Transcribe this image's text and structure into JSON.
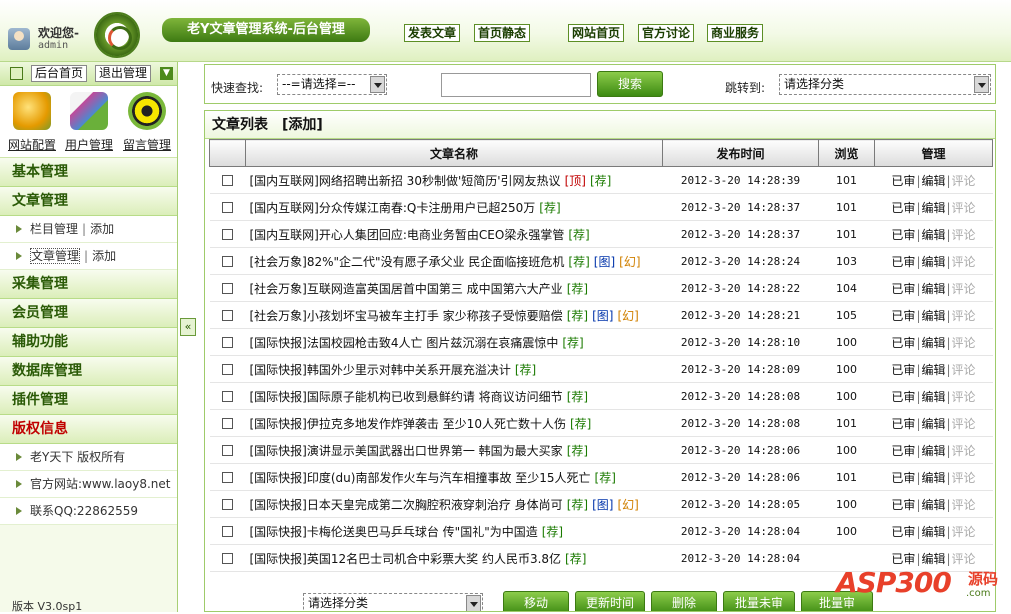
{
  "header": {
    "welcome": "欢迎您-",
    "username": "admin",
    "system_title": "老Y文章管理系统-后台管理",
    "top_buttons": [
      "发表文章",
      "首页静态",
      "网站首页",
      "官方讨论",
      "商业服务"
    ]
  },
  "sidebar": {
    "top_buttons": [
      "后台首页",
      "退出管理"
    ],
    "quick_links": [
      "网站配置",
      "用户管理",
      "留言管理"
    ],
    "menu": {
      "basic": "基本管理",
      "article": "文章管理",
      "column_manage": "栏目管理",
      "add": "添加",
      "separator": "|",
      "article_manage": "文章管理",
      "collect": "采集管理",
      "member": "会员管理",
      "assist": "辅助功能",
      "database": "数据库管理",
      "plugin": "插件管理",
      "copyright": "版权信息",
      "copyright_items": [
        "老Y天下 版权所有",
        "官方网站:www.laoy8.net",
        "联系QQ:22862559"
      ]
    },
    "footer": "版本 V3.0sp1",
    "collapse_icon": "«"
  },
  "search": {
    "quick_find_label": "快速查找:",
    "quick_find_select": "--=请选择=--",
    "keyword_value": "",
    "search_button": "搜索",
    "jump_label": "跳转到:",
    "jump_select": "请选择分类"
  },
  "list": {
    "title": "文章列表",
    "add": "[添加]",
    "columns": [
      "",
      "文章名称",
      "发布时间",
      "浏览",
      "管理"
    ],
    "manage_actions": [
      "已审",
      "编辑",
      "评论"
    ],
    "rows": [
      {
        "title": "[国内互联网]网络招聘出新招 30秒制做'短简历'引网友热议",
        "tags": [
          "[顶]",
          "[荐]"
        ],
        "time": "2012-3-20 14:28:39",
        "views": "101"
      },
      {
        "title": "[国内互联网]分众传媒江南春:Q卡注册用户已超250万",
        "tags": [
          "[荐]"
        ],
        "time": "2012-3-20 14:28:37",
        "views": "101"
      },
      {
        "title": "[国内互联网]开心人集团回应:电商业务暂由CEO梁永强掌管",
        "tags": [
          "[荐]"
        ],
        "time": "2012-3-20 14:28:37",
        "views": "101"
      },
      {
        "title": "[社会万象]82%\"企二代\"没有愿子承父业 民企面临接班危机",
        "tags": [
          "[荐]",
          "[图]",
          "[幻]"
        ],
        "time": "2012-3-20 14:28:24",
        "views": "103"
      },
      {
        "title": "[社会万象]互联网造富英国居首中国第三 成中国第六大产业",
        "tags": [
          "[荐]"
        ],
        "time": "2012-3-20 14:28:22",
        "views": "104"
      },
      {
        "title": "[社会万象]小孩划坏宝马被车主打手 家少称孩子受惊要赔偿",
        "tags": [
          "[荐]",
          "[图]",
          "[幻]"
        ],
        "time": "2012-3-20 14:28:21",
        "views": "105"
      },
      {
        "title": "[国际快报]法国校园枪击致4人亡 图片兹沉溺在哀痛震惊中",
        "tags": [
          "[荐]"
        ],
        "time": "2012-3-20 14:28:10",
        "views": "100"
      },
      {
        "title": "[国际快报]韩国外少里示对韩中关系开展充溢决计",
        "tags": [
          "[荐]"
        ],
        "time": "2012-3-20 14:28:09",
        "views": "100"
      },
      {
        "title": "[国际快报]国际原子能机构已收到悬鲜约请 将商议访问细节",
        "tags": [
          "[荐]"
        ],
        "time": "2012-3-20 14:28:08",
        "views": "100"
      },
      {
        "title": "[国际快报]伊拉克多地发作炸弹袭击 至少10人死亡数十人伤",
        "tags": [
          "[荐]"
        ],
        "time": "2012-3-20 14:28:08",
        "views": "101"
      },
      {
        "title": "[国际快报]演讲显示美国武器出口世界第一 韩国为最大买家",
        "tags": [
          "[荐]"
        ],
        "time": "2012-3-20 14:28:06",
        "views": "100"
      },
      {
        "title": "[国际快报]印度(du)南部发作火车与汽车相撞事故 至少15人死亡",
        "tags": [
          "[荐]"
        ],
        "time": "2012-3-20 14:28:06",
        "views": "101"
      },
      {
        "title": "[国际快报]日本天皇完成第二次胸腔积液穿刺治疗 身体尚可",
        "tags": [
          "[荐]",
          "[图]",
          "[幻]"
        ],
        "time": "2012-3-20 14:28:05",
        "views": "100"
      },
      {
        "title": "[国际快报]卡梅伦送奥巴马乒乓球台 传\"国礼\"为中国造",
        "tags": [
          "[荐]"
        ],
        "time": "2012-3-20 14:28:04",
        "views": "100"
      },
      {
        "title": "[国际快报]英国12名巴士司机合中彩票大奖 约人民币3.8亿",
        "tags": [
          "[荐]"
        ],
        "time": "2012-3-20 14:28:04",
        "views": ""
      }
    ],
    "bottom": {
      "select": "请选择分类",
      "buttons": [
        "移动",
        "更新时间",
        "删除",
        "批量未审",
        "批量审"
      ]
    }
  },
  "watermark": {
    "brand": "ASP300",
    "suffix": "源码",
    "sub": ".com"
  }
}
